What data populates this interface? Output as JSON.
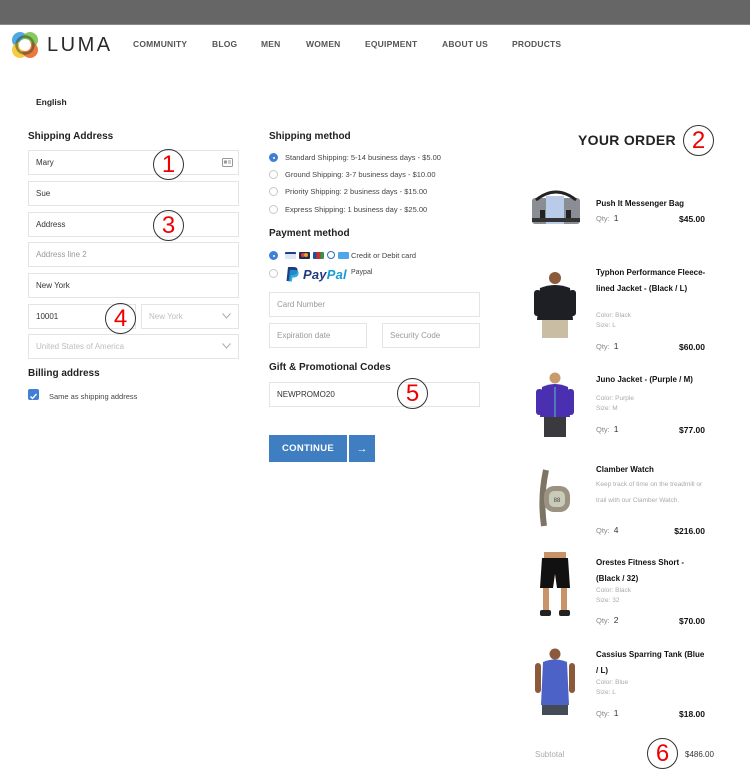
{
  "header": {
    "brand": "LUMA",
    "nav": [
      "COMMUNITY",
      "BLOG",
      "MEN",
      "WOMEN",
      "EQUIPMENT",
      "ABOUT US",
      "PRODUCTS"
    ]
  },
  "language": "English",
  "shipping_address": {
    "title": "Shipping Address",
    "first_name": "Mary",
    "last_name": "Sue",
    "address": "Address",
    "address2_placeholder": "Address line 2",
    "city": "New York",
    "zip": "10001",
    "state": "New York",
    "country": "United States of America"
  },
  "billing": {
    "title": "Billing address",
    "same_as_shipping_label": "Same as shipping address",
    "same_as_shipping_checked": true
  },
  "shipping_method": {
    "title": "Shipping method",
    "options": [
      {
        "label": "Standard Shipping: 5-14 business days - $5.00",
        "selected": true
      },
      {
        "label": "Ground Shipping: 3-7 business days - $10.00",
        "selected": false
      },
      {
        "label": "Priority Shipping: 2 business days - $15.00",
        "selected": false
      },
      {
        "label": "Express Shipping: 1 business day - $25.00",
        "selected": false
      }
    ]
  },
  "payment": {
    "title": "Payment method",
    "card_label": "Credit or Debit card",
    "card_selected": true,
    "paypal_logo_a": "Pay",
    "paypal_logo_b": "Pal",
    "paypal_label": "Paypal",
    "card_number_placeholder": "Card Number",
    "expiration_placeholder": "Expiration date",
    "security_placeholder": "Security Code",
    "card_brand_icons": [
      "visa-icon",
      "mastercard-icon",
      "jcb-icon",
      "diners-icon",
      "amex-icon"
    ]
  },
  "promo": {
    "title": "Gift & Promotional Codes",
    "value": "NEWPROMO20"
  },
  "continue_label": "CONTINUE",
  "continue_arrow": "→",
  "order": {
    "title": "YOUR ORDER",
    "qty_label": "Qty:",
    "items": [
      {
        "name": "Push It Messenger Bag",
        "qty": "1",
        "price": "$45.00"
      },
      {
        "name": "Typhon Performance Fleece-lined Jacket - (Black / L)",
        "color": "Color: Black",
        "size": "Size: L",
        "qty": "1",
        "price": "$60.00"
      },
      {
        "name": "Juno Jacket - (Purple / M)",
        "color": "Color: Purple",
        "size": "Size: M",
        "qty": "1",
        "price": "$77.00"
      },
      {
        "name": "Clamber Watch",
        "description": "Keep track of time on the treadmill or trail with our Clamber Watch.",
        "qty": "4",
        "price": "$216.00"
      },
      {
        "name": "Orestes Fitness Short - (Black / 32)",
        "color": "Color: Black",
        "size": "Size: 32",
        "qty": "2",
        "price": "$70.00"
      },
      {
        "name": "Cassius Sparring Tank (Blue / L)",
        "color": "Color: Blue",
        "size": "Size: L",
        "qty": "1",
        "price": "$18.00"
      }
    ],
    "subtotal_label": "Subtotal",
    "subtotal_value": "$486.00"
  },
  "annotations": [
    "1",
    "2",
    "3",
    "4",
    "5",
    "6"
  ],
  "colors": {
    "accent": "#3e7ec1",
    "radio_selected": "#3f7fd6",
    "annotation": "#ee0000",
    "topbar": "#666666"
  }
}
